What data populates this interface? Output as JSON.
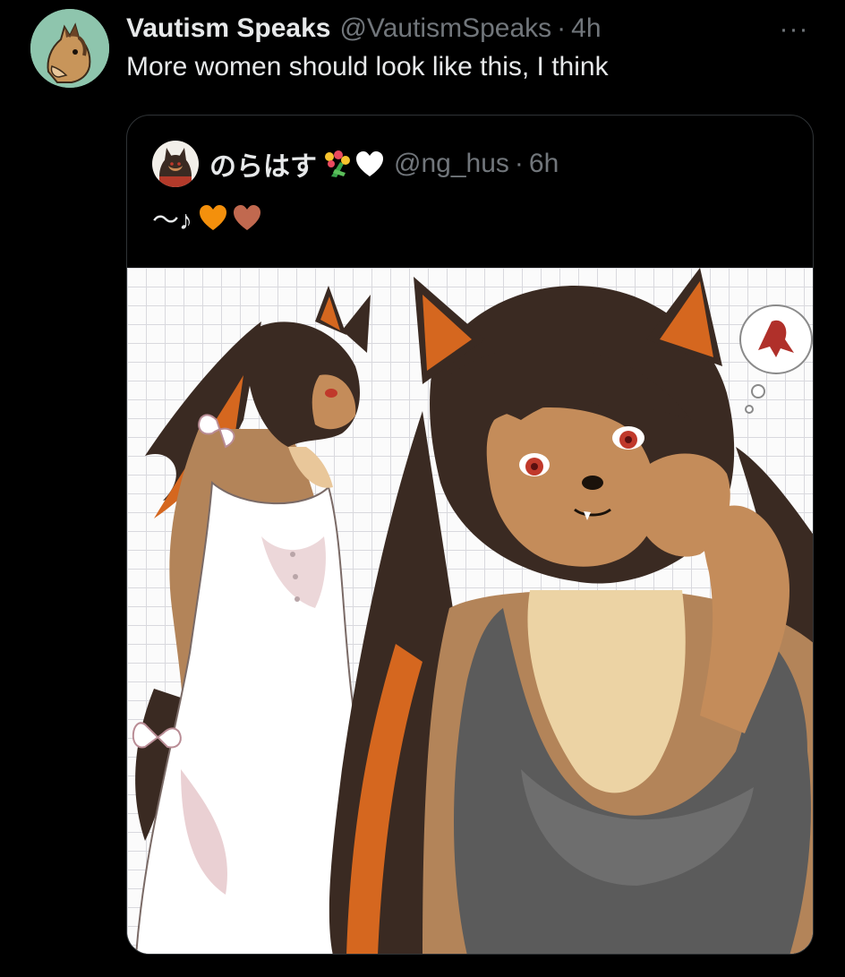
{
  "tweet": {
    "display_name": "Vautism Speaks",
    "handle": "@VautismSpeaks",
    "separator": "·",
    "timestamp": "4h",
    "text": "More women should look like this, I think",
    "more_label": "···",
    "avatar_icon": "horse-avatar"
  },
  "quote": {
    "display_name": "のらはす",
    "name_emoji": [
      "bouquet-icon",
      "white-heart-icon"
    ],
    "handle": "@ng_hus",
    "separator": "·",
    "timestamp": "6h",
    "text": "～♪",
    "text_emoji": [
      "orange-heart-icon",
      "brown-heart-icon"
    ],
    "media_icon": "anthro-dog-characters-illustration"
  },
  "colors": {
    "background": "#000000",
    "text_primary": "#e7e9ea",
    "text_secondary": "#71767b",
    "border": "#2f3336",
    "orange_heart": "#f4900c",
    "brown_heart": "#c1694f"
  }
}
